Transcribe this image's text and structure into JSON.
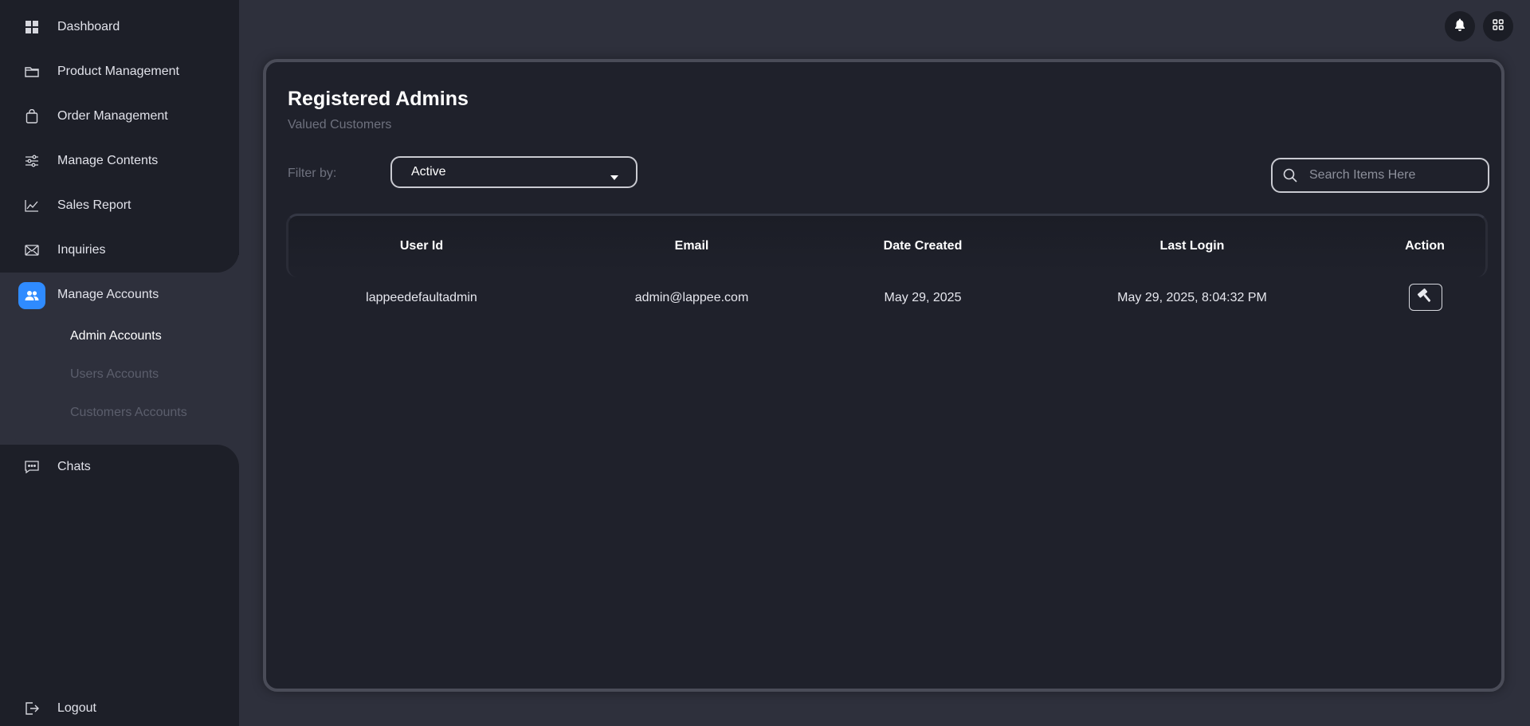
{
  "sidebar": {
    "items": [
      {
        "label": "Dashboard",
        "icon": "grid-icon"
      },
      {
        "label": "Product Management",
        "icon": "folder-icon"
      },
      {
        "label": "Order Management",
        "icon": "shopping-bag-icon"
      },
      {
        "label": "Manage Contents",
        "icon": "sliders-icon"
      },
      {
        "label": "Sales Report",
        "icon": "line-chart-icon"
      },
      {
        "label": "Inquiries",
        "icon": "mail-icon"
      },
      {
        "label": "Manage Accounts",
        "icon": "users-icon"
      },
      {
        "label": "Chats",
        "icon": "chat-icon"
      },
      {
        "label": "Logout",
        "icon": "logout-icon"
      }
    ],
    "sub_items": [
      {
        "label": "Admin Accounts"
      },
      {
        "label": "Users Accounts"
      },
      {
        "label": "Customers Accounts"
      }
    ],
    "accent_color": "#2f8bff"
  },
  "topbar": {
    "notification_icon": "bell-icon",
    "apps_icon": "apps-grid-icon"
  },
  "main": {
    "title": "Registered Admins",
    "subtitle": "Valued Customers",
    "filter_label": "Filter by:",
    "filter_value": "Active",
    "search_placeholder": "Search Items Here"
  },
  "table": {
    "columns": [
      "User Id",
      "Email",
      "Date Created",
      "Last Login",
      "Action"
    ],
    "rows": [
      {
        "user_id": "lappeedefaultadmin",
        "email": "admin@lappee.com",
        "date_created": "May 29, 2025",
        "last_login": "May 29, 2025, 8:04:32 PM",
        "action_icon": "hammer-icon"
      }
    ]
  }
}
